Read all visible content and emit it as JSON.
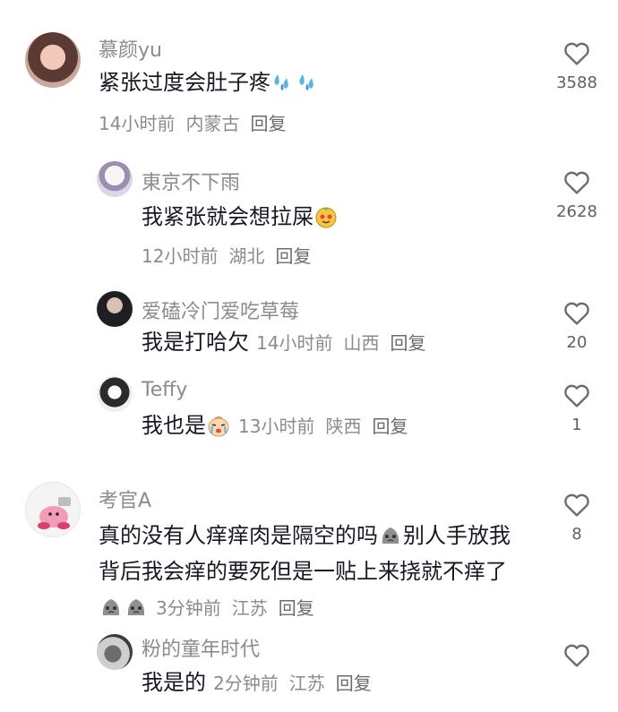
{
  "comments": [
    {
      "name": "慕颜yu",
      "text": "紧张过度会肚子疼",
      "time": "14小时前",
      "location": "内蒙古",
      "reply": "回复",
      "likes": "3588"
    },
    {
      "name": "東京不下雨",
      "text": "我紧张就会想拉屎",
      "time": "12小时前",
      "location": "湖北",
      "reply": "回复",
      "likes": "2628"
    },
    {
      "name": "爱磕冷门爱吃草莓",
      "text": "我是打哈欠",
      "time": "14小时前",
      "location": "山西",
      "reply": "回复",
      "likes": "20"
    },
    {
      "name": "Teffy",
      "text": "我也是",
      "time": "13小时前",
      "location": "陕西",
      "reply": "回复",
      "likes": "1"
    },
    {
      "name": "考官A",
      "text1": "真的没有人痒痒肉是隔空的吗",
      "text2": "别人手放我背后我会痒的要死但是一贴上来挠就不痒了",
      "time": "3分钟前",
      "location": "江苏",
      "reply": "回复",
      "likes": "8"
    },
    {
      "name": "粉的童年时代",
      "text": "我是的",
      "time": "2分钟前",
      "location": "江苏",
      "reply": "回复",
      "likes": ""
    }
  ]
}
